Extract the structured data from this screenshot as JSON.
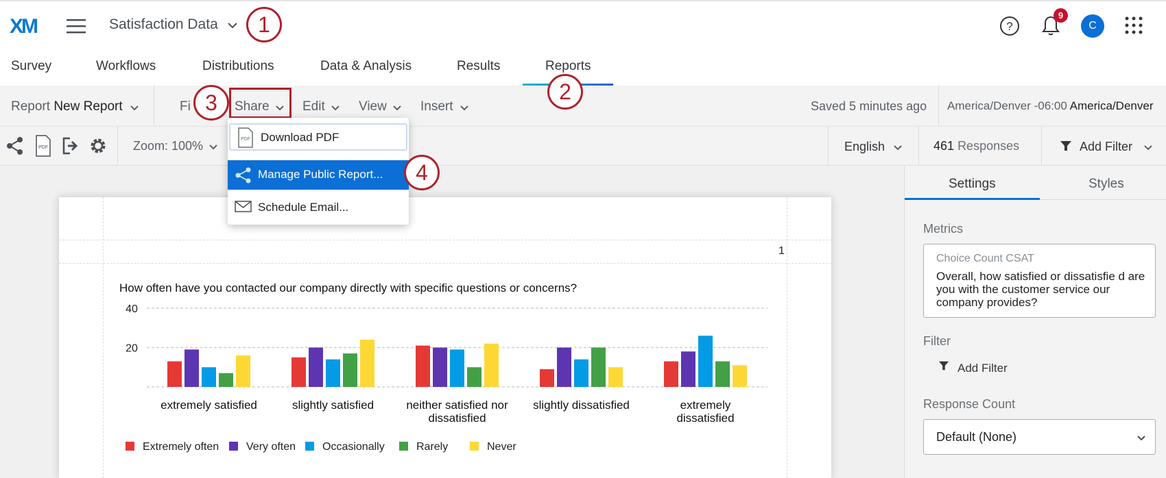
{
  "header": {
    "logo": "XM",
    "project_name": "Satisfaction Data",
    "notification_count": "9",
    "avatar_initial": "C"
  },
  "nav_tabs": [
    "Survey",
    "Workflows",
    "Distributions",
    "Data & Analysis",
    "Results",
    "Reports"
  ],
  "active_tab": "Reports",
  "report_bar": {
    "report_label": "Report",
    "report_name": "New Report",
    "menus": [
      "File",
      "Share",
      "Edit",
      "View",
      "Insert"
    ],
    "file_visible": "Fi",
    "saved_status": "Saved 5 minutes ago",
    "timezone_offset": "America/Denver -06:00",
    "timezone_name": "America/Denver"
  },
  "toolbar2": {
    "zoom": "Zoom: 100%",
    "language": "English",
    "response_count": "461",
    "responses_label": "Responses",
    "add_filter": "Add Filter"
  },
  "share_menu": {
    "items": [
      "Download PDF",
      "Manage Public Report...",
      "Schedule Email..."
    ],
    "pdf_icon_text": "PDF"
  },
  "steps": [
    "1",
    "2",
    "3",
    "4"
  ],
  "page": {
    "page_number": "1"
  },
  "chart_data": {
    "type": "bar",
    "title": "How often have you contacted our company directly with specific questions or concerns?",
    "categories": [
      [
        "extremely satisfied"
      ],
      [
        "slightly satisfied"
      ],
      [
        "neither satisfied nor",
        "dissatisfied"
      ],
      [
        "slightly dissatisfied"
      ],
      [
        "extremely",
        "dissatisfied"
      ]
    ],
    "ytick_labels": [
      "40",
      "20"
    ],
    "ylim": [
      0,
      40
    ],
    "gridlines": [
      0,
      20,
      40
    ],
    "series": [
      {
        "name": "Extremely often",
        "color": "#e53935",
        "values": [
          13,
          15,
          21,
          9,
          13
        ]
      },
      {
        "name": "Very often",
        "color": "#5e35b1",
        "values": [
          19,
          20,
          20,
          20,
          18
        ]
      },
      {
        "name": "Occasionally",
        "color": "#039be5",
        "values": [
          10,
          14,
          19,
          14,
          26
        ]
      },
      {
        "name": "Rarely",
        "color": "#43a047",
        "values": [
          7,
          17,
          10,
          20,
          13
        ]
      },
      {
        "name": "Never",
        "color": "#fdd835",
        "values": [
          16,
          24,
          22,
          10,
          11
        ]
      }
    ],
    "legend_position": "bottom-left",
    "grid": true
  },
  "right_panel": {
    "tabs": [
      "Settings",
      "Styles"
    ],
    "metrics_label": "Metrics",
    "metric_type": "Choice Count CSAT",
    "metric_question": "Overall, how satisfied or dissatisfie d are you with the customer service our company provides?",
    "filter_label": "Filter",
    "add_filter": "Add Filter",
    "response_count_label": "Response Count",
    "response_count_value": "Default (None)"
  },
  "colors": {
    "brand_blue": "#0b6fd6",
    "annotation_red": "#b0202b",
    "badge_red": "#c8102e"
  }
}
